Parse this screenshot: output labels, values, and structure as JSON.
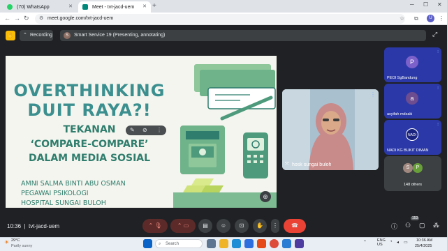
{
  "browser": {
    "tabs": [
      {
        "label": "(70) WhatsApp"
      },
      {
        "label": "Meet - tvt-jacd-uem"
      }
    ],
    "url": "meet.google.com/tvt-jacd-uem",
    "profile_initial": "U"
  },
  "meet": {
    "recording_label": "Recording",
    "presenter_avatar": "S",
    "presenter_label": "Smart Service 19 (Presenting, annotating)",
    "meeting_time": "10:36",
    "meeting_code": "tvt-jacd-uem",
    "participant_badge": "153"
  },
  "slide": {
    "title_line1": "OVERTHINKING",
    "title_line2": "DUIT RAYA?!",
    "subtitle_line1": "TEKANAN",
    "subtitle_line2": "‘COMPARE-COMPARE’",
    "subtitle_line3": "DALAM MEDIA SOSIAL",
    "speaker_name": "AMNI SALMA BINTI ABU OSMAN",
    "speaker_role": "PEGAWAI PSIKOLOGI",
    "speaker_org": "HOSPITAL SUNGAI BULOH"
  },
  "presenter_video": {
    "name": "hosk sungai buloh"
  },
  "participants": [
    {
      "initial": "P",
      "name": "PEOI SgBandung",
      "color": "#7b61c9"
    },
    {
      "initial": "a",
      "name": "asyifah mdzaki",
      "color": "#6d4c8f"
    },
    {
      "initial": "NADI",
      "name": "NADI KG BUKIT DIMAN",
      "color": "#1a237e"
    }
  ],
  "others": {
    "initial_1": "S",
    "initial_2": "P",
    "label": "148 others"
  },
  "taskbar": {
    "weather_temp": "29°C",
    "weather_desc": "Partly sunny",
    "search_placeholder": "Search",
    "lang_1": "ENG",
    "lang_2": "US",
    "time": "10:36 AM",
    "date": "25/4/2025"
  }
}
